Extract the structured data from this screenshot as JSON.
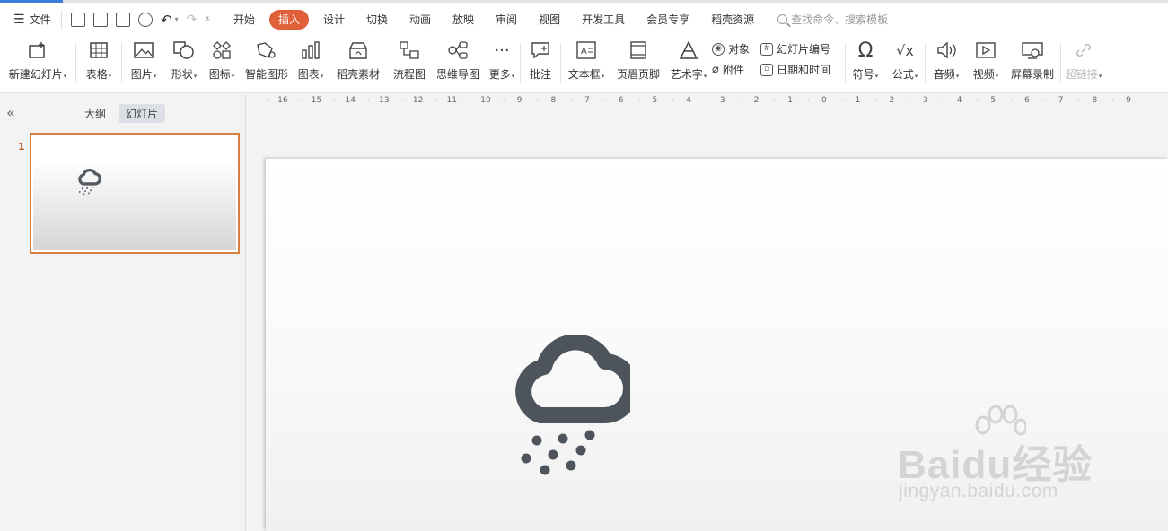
{
  "menubar": {
    "file_label": "文件",
    "tabs": [
      {
        "label": "开始",
        "active": false
      },
      {
        "label": "插入",
        "active": true
      },
      {
        "label": "设计",
        "active": false
      },
      {
        "label": "切换",
        "active": false
      },
      {
        "label": "动画",
        "active": false
      },
      {
        "label": "放映",
        "active": false
      },
      {
        "label": "审阅",
        "active": false
      },
      {
        "label": "视图",
        "active": false
      },
      {
        "label": "开发工具",
        "active": false
      },
      {
        "label": "会员专享",
        "active": false
      },
      {
        "label": "稻壳资源",
        "active": false
      }
    ],
    "search_placeholder": "查找命令、搜索模板",
    "active_color": "#e0603a"
  },
  "ribbon": {
    "new_slide": "新建幻灯片",
    "table": "表格",
    "picture": "图片",
    "shape": "形状",
    "icon": "图标",
    "smart_graphic": "智能图形",
    "chart": "图表",
    "docer_material": "稻壳素材",
    "flowchart": "流程图",
    "mindmap": "思维导图",
    "more": "更多",
    "comment": "批注",
    "textbox": "文本框",
    "header_footer": "页眉页脚",
    "wordart": "艺术字",
    "object": "对象",
    "attachment": "附件",
    "slide_number": "幻灯片编号",
    "date_time": "日期和时间",
    "symbol": "符号",
    "formula": "公式",
    "audio": "音频",
    "video": "视频",
    "screen_record": "屏幕录制",
    "hyperlink": "超链接"
  },
  "leftpane": {
    "outline_tab": "大纲",
    "slides_tab": "幻灯片",
    "slide_number": "1",
    "thumb_border_color": "#d6803f"
  },
  "ruler": {
    "labels": [
      "16",
      "15",
      "14",
      "13",
      "12",
      "11",
      "10",
      "9",
      "8",
      "7",
      "6",
      "5",
      "4",
      "3",
      "2",
      "1",
      "0",
      "1",
      "2",
      "3",
      "4",
      "5",
      "6",
      "7",
      "8",
      "9"
    ]
  },
  "slide": {
    "icon": "cloud-rain-icon",
    "icon_color": "#4d545c"
  },
  "watermark": {
    "brand": "Baidu经验",
    "url": "jingyan.baidu.com"
  }
}
